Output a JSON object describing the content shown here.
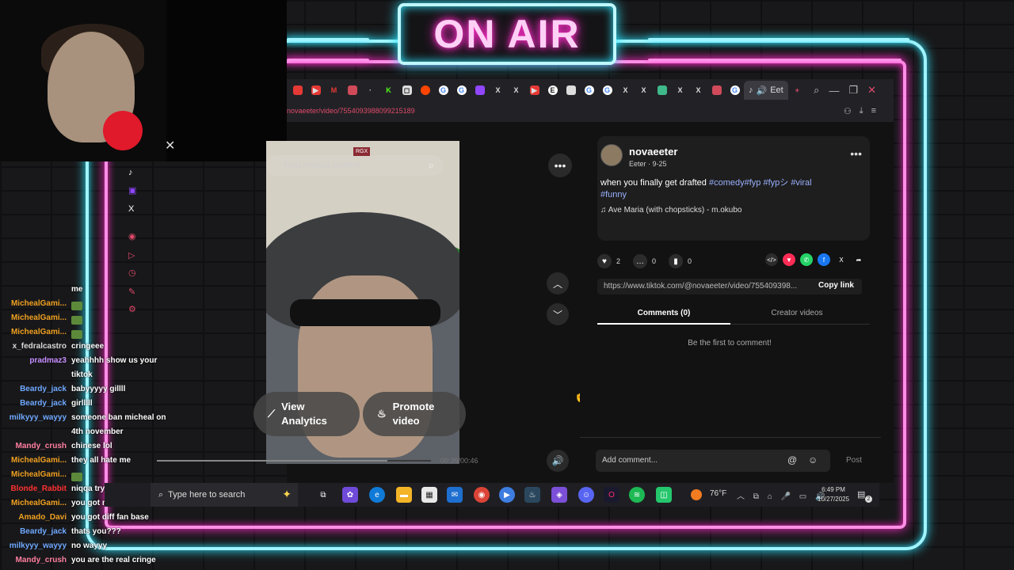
{
  "overlay": {
    "on_air": "ON AIR"
  },
  "browser": {
    "url": "novaeeter/video/7554093988099215189",
    "active_tab": "Eet"
  },
  "video": {
    "search_placeholder": "Find related content",
    "badge": "RGX",
    "analytics_label_1": "View",
    "analytics_label_2": "Analytics",
    "promote_label_1": "Promote",
    "promote_label_2": "video",
    "time": "00:39/00:46",
    "progress_fraction": 0.84
  },
  "post": {
    "author": "novaeeter",
    "author_sub": "Eeter · 9-25",
    "caption_text": "when you finally get drafted ",
    "hashtags_line1": "#comedy#fyp #fypシ #viral",
    "hashtags_line2": "#funny",
    "music": "Ave Maria (with chopsticks) - m.okubo",
    "likes": "2",
    "comments": "0",
    "saves": "0",
    "link": "https://www.tiktok.com/@novaeeter/video/755409398...",
    "copy_link": "Copy link",
    "tab_comments": "Comments (0)",
    "tab_creator": "Creator videos",
    "empty_comments": "Be the first to comment!",
    "comment_placeholder": "Add comment...",
    "post_button": "Post"
  },
  "chat": [
    {
      "user": "",
      "msg": "me",
      "color": "#ffffff",
      "emote": false
    },
    {
      "user": "MichealGami...",
      "msg": "",
      "color": "#f0a020",
      "emote": true
    },
    {
      "user": "MichealGami...",
      "msg": "",
      "color": "#f0a020",
      "emote": true
    },
    {
      "user": "MichealGami...",
      "msg": "",
      "color": "#f0a020",
      "emote": true
    },
    {
      "user": "x_fedralcastro",
      "msg": "cringeee",
      "color": "#d8d8d8",
      "emote": false
    },
    {
      "user": "pradmaz3",
      "msg": "yeahhhh show us your",
      "color": "#c58cff",
      "emote": false
    },
    {
      "user": "",
      "msg": "tiktok",
      "color": "#ffffff",
      "emote": false
    },
    {
      "user": "Beardy_jack",
      "msg": "babyyyyy gillll",
      "color": "#6fa8ff",
      "emote": false
    },
    {
      "user": "Beardy_jack",
      "msg": "girlllll",
      "color": "#6fa8ff",
      "emote": false
    },
    {
      "user": "milkyyy_wayyy",
      "msg": "someone ban micheal on",
      "color": "#6fa8ff",
      "emote": false
    },
    {
      "user": "",
      "msg": "4th november",
      "color": "#ffffff",
      "emote": false
    },
    {
      "user": "Mandy_crush",
      "msg": "chinese lol",
      "color": "#ff7fa0",
      "emote": false
    },
    {
      "user": "MichealGami...",
      "msg": "they all hate me",
      "color": "#f0a020",
      "emote": false
    },
    {
      "user": "MichealGami...",
      "msg": "",
      "color": "#f0a020",
      "emote": true
    },
    {
      "user": "Blonde_Rabbit",
      "msg": "niqqa trying to fuck",
      "color": "#ff3030",
      "emote": false
    },
    {
      "user": "MichealGami...",
      "msg": "you got million views",
      "color": "#f0a020",
      "emote": false
    },
    {
      "user": "Amado_Davi",
      "msg": "you got diff fan base",
      "color": "#f0a020",
      "emote": false
    },
    {
      "user": "Beardy_jack",
      "msg": "thats you???",
      "color": "#6fa8ff",
      "emote": false
    },
    {
      "user": "milkyyy_wayyy",
      "msg": "no wayyy",
      "color": "#6fa8ff",
      "emote": false
    },
    {
      "user": "Mandy_crush",
      "msg": "you are the real cringe",
      "color": "#ff7fa0",
      "emote": false
    }
  ],
  "taskbar": {
    "search_placeholder": "Type here to search",
    "weather": "76°F",
    "time": "6:49 PM",
    "date": "10/27/2025",
    "notif_count": "2"
  },
  "colors": {
    "neon_cyan": "#2ee6ff",
    "neon_pink": "#ff2cc8",
    "hashtag": "#9ab0ff",
    "url": "#e04a6a"
  }
}
